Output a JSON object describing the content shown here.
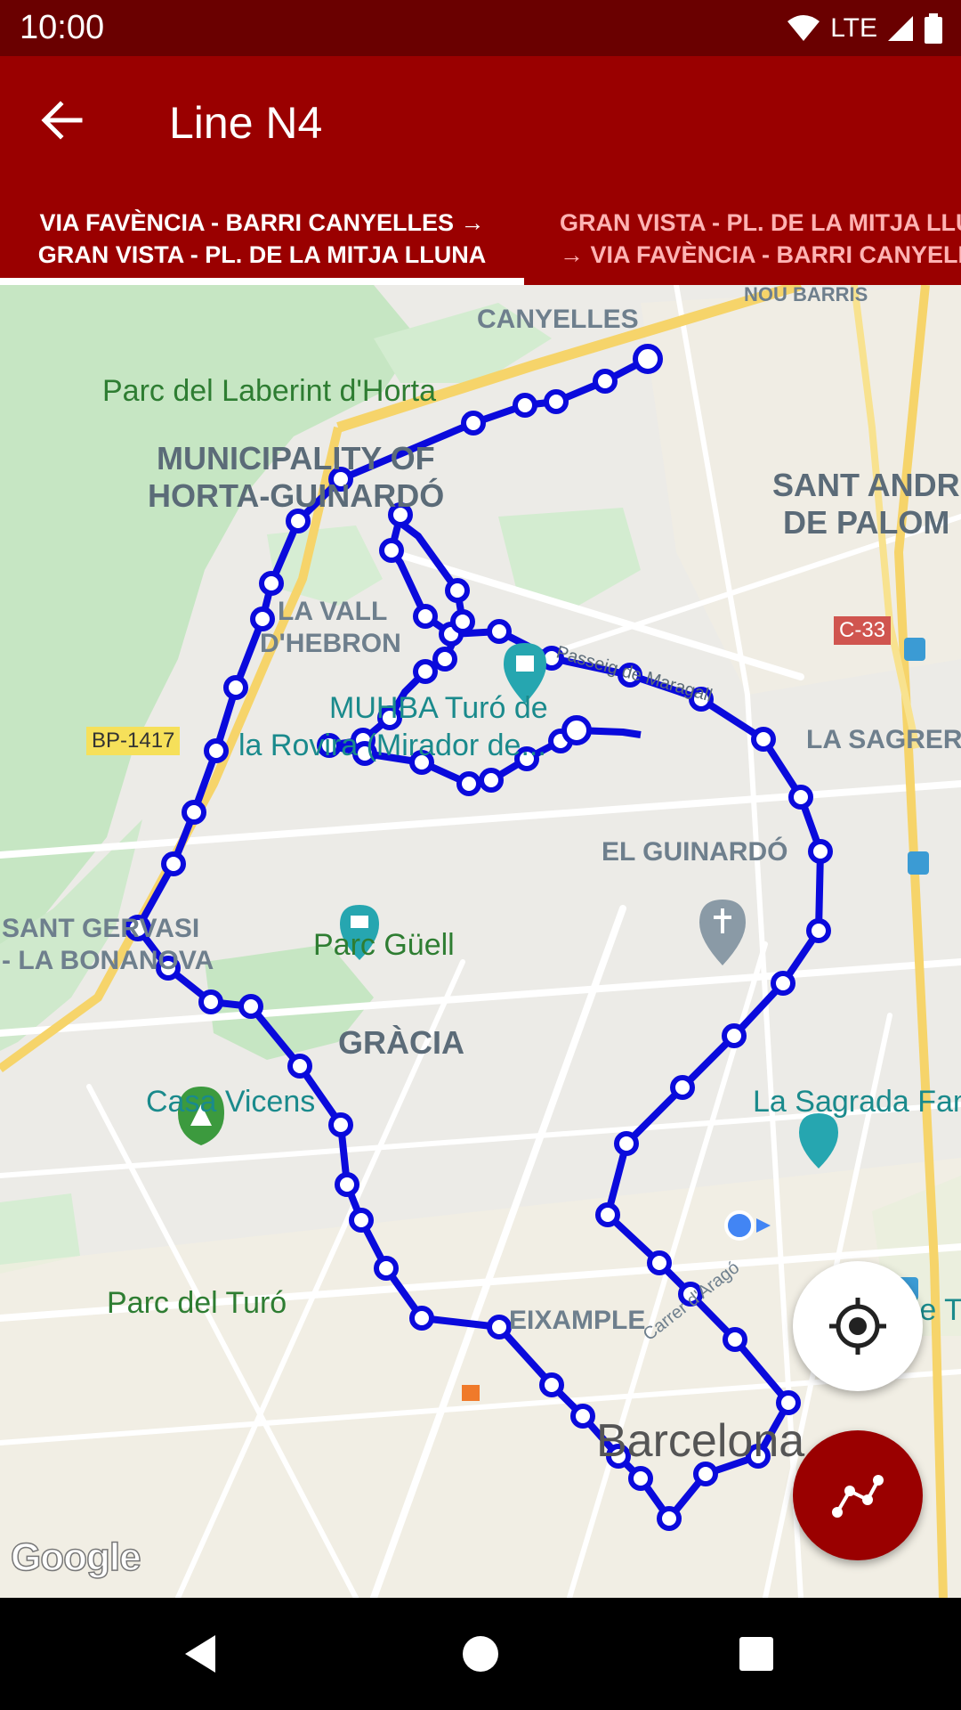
{
  "status": {
    "time": "10:00",
    "network": "LTE"
  },
  "app_bar": {
    "title": "Line N4",
    "back_icon": "arrow-back-icon"
  },
  "tabs": [
    {
      "line1": "VIA FAVÈNCIA - BARRI CANYELLES →",
      "line2": "GRAN VISTA - PL. DE LA MITJA LLUNA",
      "selected": true
    },
    {
      "line1": "GRAN VISTA - PL. DE LA MITJA LLUNA →",
      "line2": "→ VIA FAVÈNCIA - BARRI CANYELLES",
      "selected": false
    }
  ],
  "map": {
    "labels": {
      "nou_barris": "NOU BARRIS",
      "canyelles": "CANYELLES",
      "laberint": "Parc del Laberint d'Horta",
      "horta1": "MUNICIPALITY OF",
      "horta2": "HORTA-GUINARDÓ",
      "sant_andreu1": "SANT ANDR",
      "sant_andreu2": "DE PALOM",
      "vall1": "LA VALL",
      "vall2": "D'HEBRON",
      "muhba1": "MUHBA Turó de",
      "muhba2": "la Rovira (Mirador de...",
      "passeig": "Passeig de Maragall",
      "sagrera": "LA SAGRERA",
      "guinardo": "EL GUINARDÓ",
      "gervasi1": "SANT GERVASI",
      "gervasi2": "- LA BONANOVA",
      "guell": "Parc Güell",
      "gracia": "GRÀCIA",
      "vicens": "Casa Vicens",
      "sagrada": "La Sagrada Fam",
      "turo": "Parc del Turó",
      "eixample": "EIXAMPLE",
      "arc": "Arc de Tr",
      "arago": "Carrer d'Aragó",
      "barcelona": "Barcelona",
      "google": "Google"
    },
    "road_badges": {
      "bp": "BP-1417",
      "c33": "C-33"
    },
    "route_color": "#0a0adc",
    "park_color": "#c6e6c3"
  },
  "fabs": {
    "my_location_icon": "my-location-icon",
    "route_icon": "route-icon"
  },
  "nav": {
    "back": "nav-back-icon",
    "home": "nav-home-icon",
    "recents": "nav-recents-icon"
  }
}
